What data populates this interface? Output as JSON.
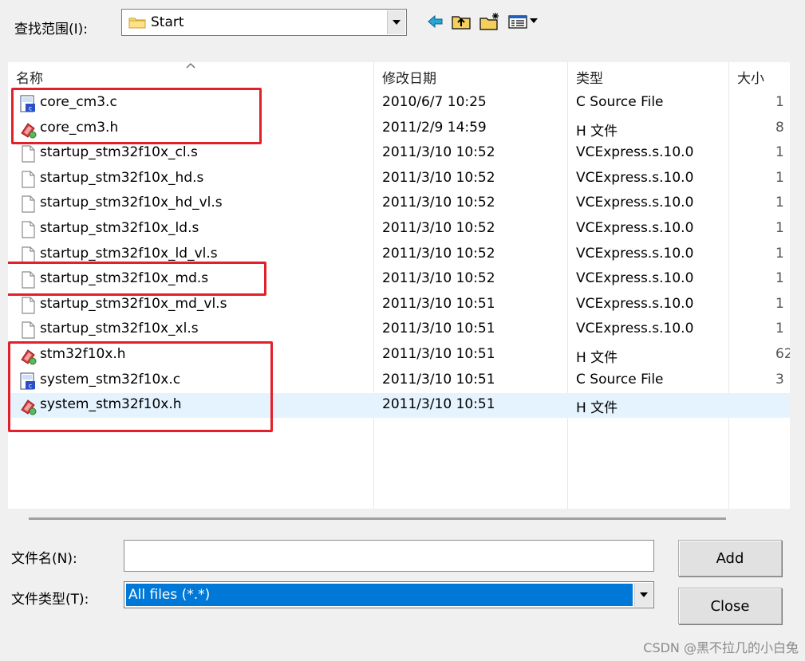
{
  "toolbar": {
    "look_in_label": "查找范围(I):",
    "look_in_value": "Start",
    "icons": [
      "back-arrow-icon",
      "up-folder-icon",
      "new-folder-icon",
      "view-menu-icon"
    ]
  },
  "list": {
    "columns": [
      "名称",
      "修改日期",
      "类型",
      "大小"
    ],
    "rows": [
      {
        "name": "core_cm3.c",
        "date": "2010/6/7 10:25",
        "type": "C Source File",
        "size": "1",
        "icon": "c-source-file-icon"
      },
      {
        "name": "core_cm3.h",
        "date": "2011/2/9 14:59",
        "type": "H 文件",
        "size": "8",
        "icon": "h-header-file-icon"
      },
      {
        "name": "startup_stm32f10x_cl.s",
        "date": "2011/3/10 10:52",
        "type": "VCExpress.s.10.0",
        "size": "1",
        "icon": "blank-file-icon"
      },
      {
        "name": "startup_stm32f10x_hd.s",
        "date": "2011/3/10 10:52",
        "type": "VCExpress.s.10.0",
        "size": "1",
        "icon": "blank-file-icon"
      },
      {
        "name": "startup_stm32f10x_hd_vl.s",
        "date": "2011/3/10 10:52",
        "type": "VCExpress.s.10.0",
        "size": "1",
        "icon": "blank-file-icon"
      },
      {
        "name": "startup_stm32f10x_ld.s",
        "date": "2011/3/10 10:52",
        "type": "VCExpress.s.10.0",
        "size": "1",
        "icon": "blank-file-icon"
      },
      {
        "name": "startup_stm32f10x_ld_vl.s",
        "date": "2011/3/10 10:52",
        "type": "VCExpress.s.10.0",
        "size": "1",
        "icon": "blank-file-icon"
      },
      {
        "name": "startup_stm32f10x_md.s",
        "date": "2011/3/10 10:52",
        "type": "VCExpress.s.10.0",
        "size": "1",
        "icon": "blank-file-icon"
      },
      {
        "name": "startup_stm32f10x_md_vl.s",
        "date": "2011/3/10 10:51",
        "type": "VCExpress.s.10.0",
        "size": "1",
        "icon": "blank-file-icon"
      },
      {
        "name": "startup_stm32f10x_xl.s",
        "date": "2011/3/10 10:51",
        "type": "VCExpress.s.10.0",
        "size": "1",
        "icon": "blank-file-icon"
      },
      {
        "name": "stm32f10x.h",
        "date": "2011/3/10 10:51",
        "type": "H 文件",
        "size": "62",
        "icon": "h-header-file-icon"
      },
      {
        "name": "system_stm32f10x.c",
        "date": "2011/3/10 10:51",
        "type": "C Source File",
        "size": "3",
        "icon": "c-source-file-icon"
      },
      {
        "name": "system_stm32f10x.h",
        "date": "2011/3/10 10:51",
        "type": "H 文件",
        "size": "",
        "icon": "h-header-file-icon"
      }
    ],
    "selected_index": 12
  },
  "form": {
    "filename_label": "文件名(N):",
    "filename_value": "",
    "filetype_label": "文件类型(T):",
    "filetype_value": "All files (*.*)",
    "add_label": "Add",
    "close_label": "Close"
  },
  "watermark": "CSDN @黑不拉几的小白兔",
  "colors": {
    "highlight_box": "#e3202a",
    "selection": "#0078d7",
    "row_hover": "#e5f3ff"
  }
}
